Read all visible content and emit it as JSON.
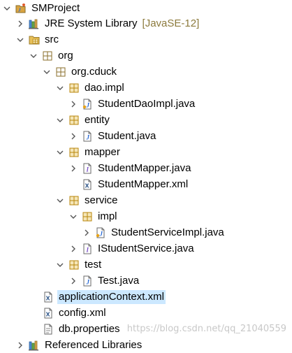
{
  "tree": {
    "project": "SMProject",
    "jre": {
      "label": "JRE System Library",
      "decoration": "[JavaSE-12]"
    },
    "src": "src",
    "pkg_org": "org",
    "pkg_cduck": "org.cduck",
    "pkg_dao": "dao.impl",
    "file_dao_impl": "StudentDaoImpl.java",
    "pkg_entity": "entity",
    "file_student": "Student.java",
    "pkg_mapper": "mapper",
    "file_mapper_java": "StudentMapper.java",
    "file_mapper_xml": "StudentMapper.xml",
    "pkg_service": "service",
    "pkg_impl": "impl",
    "file_service_impl": "StudentServiceImpl.java",
    "file_iservice": "IStudentService.java",
    "pkg_test": "test",
    "file_test": "Test.java",
    "file_appctx": "applicationContext.xml",
    "file_config": "config.xml",
    "file_dbprops": "db.properties",
    "partial_last_row": "Referenced Libraries"
  },
  "watermark": "https://blog.csdn.net/qq_21040559",
  "colors": {
    "selection": "#cce8ff",
    "decoration": "#8c7a3c",
    "package_icon": "#b8860b",
    "java_icon_blue": "#2a6bd6",
    "chevron": "#555555"
  }
}
